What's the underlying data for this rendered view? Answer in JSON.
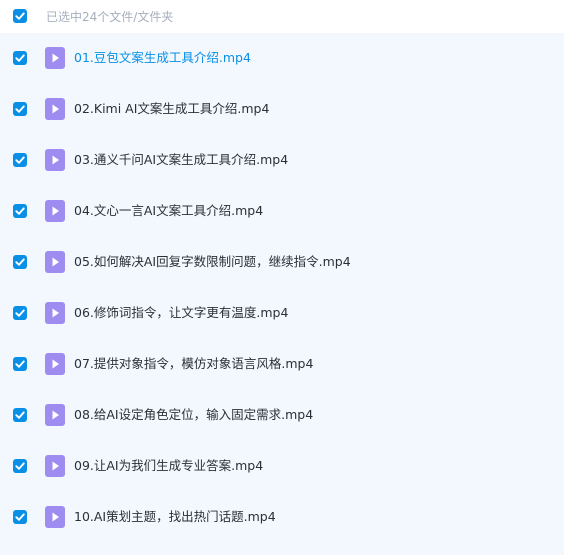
{
  "header": {
    "selection_summary": "已选中24个文件/文件夹",
    "select_all_checked": true
  },
  "colors": {
    "accent": "#0a8fe6",
    "list_background": "#f2f8fd",
    "file_icon": "#9f8cf0",
    "summary_text": "#a6afbd"
  },
  "files": [
    {
      "name": "01.豆包文案生成工具介绍.mp4",
      "checked": true,
      "icon": "video-file-icon",
      "active": true
    },
    {
      "name": "02.Kimi AI文案生成工具介绍.mp4",
      "checked": true,
      "icon": "video-file-icon"
    },
    {
      "name": "03.通义千问AI文案生成工具介绍.mp4",
      "checked": true,
      "icon": "video-file-icon"
    },
    {
      "name": "04.文心一言AI文案工具介绍.mp4",
      "checked": true,
      "icon": "video-file-icon"
    },
    {
      "name": "05.如何解决AI回复字数限制问题，继续指令.mp4",
      "checked": true,
      "icon": "video-file-icon"
    },
    {
      "name": "06.修饰词指令，让文字更有温度.mp4",
      "checked": true,
      "icon": "video-file-icon"
    },
    {
      "name": "07.提供对象指令，模仿对象语言风格.mp4",
      "checked": true,
      "icon": "video-file-icon"
    },
    {
      "name": "08.给AI设定角色定位，输入固定需求.mp4",
      "checked": true,
      "icon": "video-file-icon"
    },
    {
      "name": "09.让AI为我们生成专业答案.mp4",
      "checked": true,
      "icon": "video-file-icon"
    },
    {
      "name": "10.AI策划主题，找出热门话题.mp4",
      "checked": true,
      "icon": "video-file-icon"
    }
  ]
}
